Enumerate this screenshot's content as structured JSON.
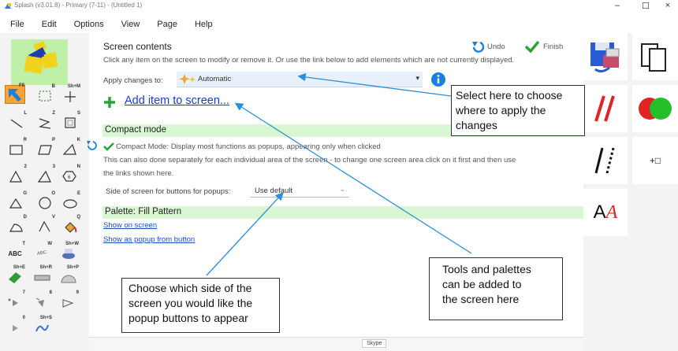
{
  "window": {
    "title": "Splash (v3.01.8) - Primary (7-11) - (Untitled 1)",
    "controls": [
      "–",
      "☐",
      "×"
    ]
  },
  "menu": [
    "File",
    "Edit",
    "Options",
    "View",
    "Page",
    "Help"
  ],
  "tool_keys": [
    "F9",
    "B",
    "Sh+M",
    "L",
    "Z",
    "S",
    "R",
    "P",
    "K",
    "2",
    "3",
    "N",
    "G",
    "O",
    "E",
    "D",
    "V",
    "Q",
    "T",
    "W",
    "Sh+W",
    "Sh+E",
    "Sh+R",
    "Sh+P",
    "7",
    "8",
    "9",
    "0",
    "Sh+S"
  ],
  "tool_labels": {
    "text_abc": "ABC",
    "text_abc_small": "ABC",
    "text_abc_2": "ABC"
  },
  "screen_contents": {
    "title": "Screen contents",
    "undo": "Undo",
    "finish": "Finish",
    "description": "Click any item on the screen to modify or remove it.  Or use the link below to add elements which are not currently displayed.",
    "apply_label": "Apply changes to:",
    "apply_value": "Automatic",
    "add_item": "Add item to screen..."
  },
  "compact": {
    "title": "Compact mode",
    "status": "Compact Mode: Display most functions as popups, appearing only when clicked",
    "description_line1": "This can also done separately for each individual area of the screen - to change one screen area click on it first and then use",
    "description_line2": "the links shown here.",
    "side_label": "Side of screen for buttons for popups:",
    "side_value": "Use default"
  },
  "palette": {
    "title": "Palette: Fill Pattern",
    "show_on_screen": "Show on screen",
    "show_popup": "Show as popup from button"
  },
  "callouts": {
    "apply": [
      "Select here to choose",
      "where to apply the",
      "changes"
    ],
    "tools": [
      "Tools and palettes",
      "can be added to",
      "the screen here"
    ],
    "side": [
      "Choose which side of the",
      "screen you would like the",
      "popup buttons to appear"
    ]
  },
  "right_tools": {
    "font_label": "A",
    "font_italic": "A",
    "plus_box": "+□"
  },
  "taskbar": {
    "skype": "Skype"
  },
  "colors": {
    "accent_green": "#d9f7d3",
    "link_blue": "#1a4ec4",
    "arrow_blue": "#2a8fd6",
    "selected_tool": "#f5a33a"
  }
}
